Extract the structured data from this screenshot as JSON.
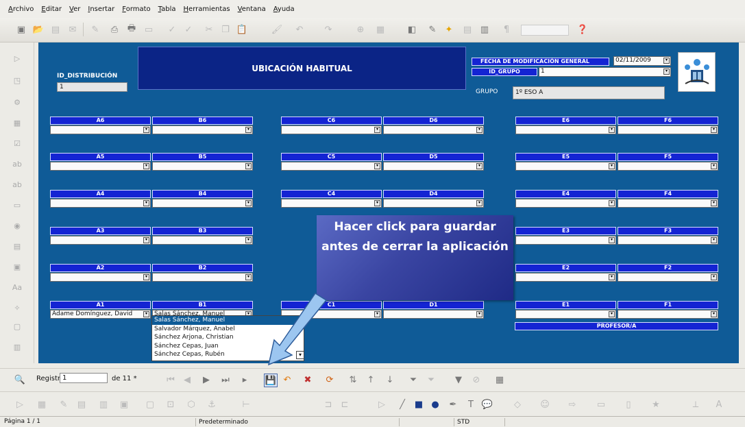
{
  "menu": [
    "Archivo",
    "Editar",
    "Ver",
    "Insertar",
    "Formato",
    "Tabla",
    "Herramientas",
    "Ventana",
    "Ayuda"
  ],
  "form": {
    "title": "UBICACIÓN HABITUAL",
    "id_distribucion_label": "ID_DISTRIBUCIÓN",
    "id_distribucion_value": "1",
    "fecha_label": "FECHA DE MODIFICACIÓN GENERAL",
    "fecha_value": "02/11/2009",
    "id_grupo_label": "ID_GRUPO",
    "id_grupo_value": "1",
    "grupo_label": "GRUPO",
    "grupo_value": "1º ESO A",
    "profesor_label": "PROFESOR/A",
    "seats": {
      "A6": "",
      "B6": "",
      "C6": "",
      "D6": "",
      "E6": "",
      "F6": "",
      "A5": "",
      "B5": "",
      "C5": "",
      "D5": "",
      "E5": "",
      "F5": "",
      "A4": "",
      "B4": "",
      "C4": "",
      "D4": "",
      "E4": "",
      "F4": "",
      "A3": "",
      "B3": "",
      "E3": "",
      "F3": "",
      "A2": "",
      "B2": "",
      "E2": "",
      "F2": "",
      "A1": "Adame Domínguez, David",
      "B1": "Salas Sánchez, Manuel",
      "C1": "",
      "D1": "",
      "E1": "",
      "F1": ""
    }
  },
  "dropdown_options": [
    "Salas Sánchez, Manuel",
    "Salvador Márquez, Anabel",
    "Sánchez Arjona, Christian",
    "Sánchez Cepas, Juan",
    "Sánchez Cepas, Rubén"
  ],
  "callout_text": "Hacer click para guardar antes de cerrar la aplicación",
  "navigation": {
    "registro_label": "Registro",
    "registro_value": "1",
    "total": "de 11 *"
  },
  "status": {
    "page": "Página 1 / 1",
    "style": "Predeterminado",
    "mode": "STD"
  },
  "colors": {
    "form_bg": "#0f5b97",
    "header_blue": "#1424d3",
    "banner": "#0b2486"
  }
}
